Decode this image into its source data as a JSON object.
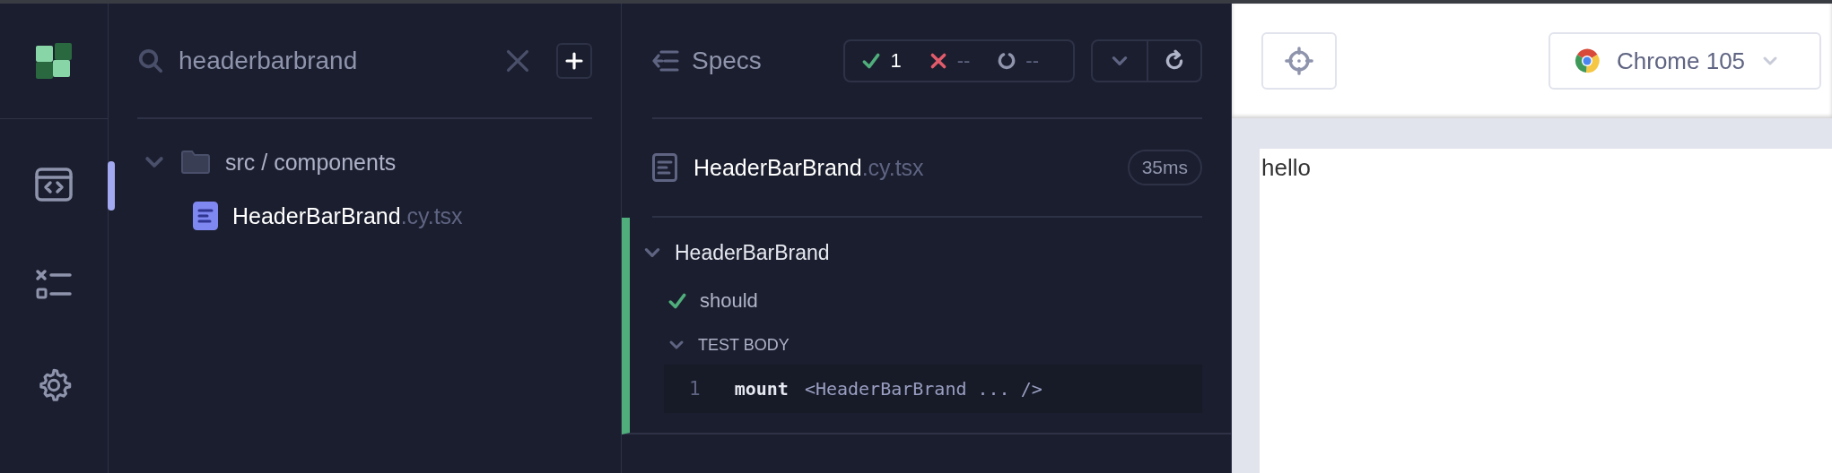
{
  "nav": {
    "items": [
      {
        "kind": "specs",
        "selected": true
      },
      {
        "kind": "runs",
        "selected": false
      },
      {
        "kind": "settings",
        "selected": false
      }
    ]
  },
  "search": {
    "value": "headerbarbrand"
  },
  "tree": [
    {
      "label": "src / components",
      "expanded": true,
      "children": [
        {
          "name": "HeaderBarBrand",
          "ext": ".cy.tsx"
        }
      ]
    }
  ],
  "specs": {
    "title": "Specs",
    "stats": {
      "passed": "1",
      "failed": "--",
      "pending": "--"
    },
    "file": {
      "name": "HeaderBarBrand",
      "ext": ".cy.tsx",
      "duration": "35ms"
    },
    "suite": {
      "title": "HeaderBarBrand",
      "expanded": true,
      "tests": [
        {
          "title": "should",
          "passed": true,
          "body": {
            "label": "TEST BODY",
            "expanded": true,
            "commands": [
              {
                "number": "1",
                "name": "mount",
                "message": "<HeaderBarBrand ... />"
              }
            ]
          }
        }
      ]
    }
  },
  "browser": {
    "name": "Chrome 105"
  },
  "preview": {
    "text": "hello"
  }
}
